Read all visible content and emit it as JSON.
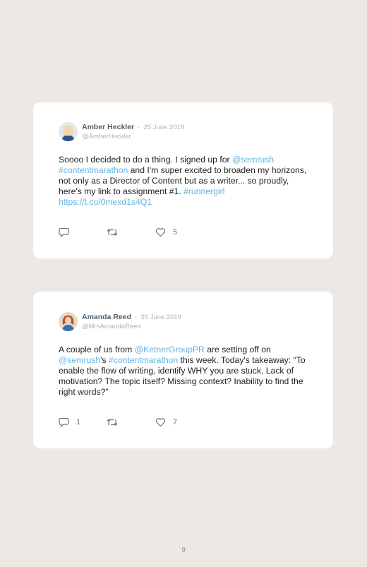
{
  "tweets": [
    {
      "name": "Amber Heckler",
      "separator": "·",
      "date": "25 June 2019",
      "handle": "@AmberHeckler",
      "avatar": "avatar-blonde-woman",
      "body_parts": [
        {
          "t": "Soooo I decided to do a thing. I signed up for "
        },
        {
          "t": "@semrush",
          "link": true
        },
        {
          "t": " "
        },
        {
          "t": "#contentmarathon",
          "link": true
        },
        {
          "t": " and I'm super excited to broaden my horizons, not only as a Director of Content but as a writer... so proudly, here's my link to assignment #1. "
        },
        {
          "t": "#runnergirl",
          "link": true
        },
        {
          "t": " "
        },
        {
          "t": "https://t.co/0mexd1s4Q1",
          "link": true
        }
      ],
      "replies": "",
      "likes": "5"
    },
    {
      "name": "Amanda Reed",
      "separator": "·",
      "date": "25 June 2019",
      "handle": "@MrsAmandaReed",
      "avatar": "avatar-redhead-woman",
      "body_parts": [
        {
          "t": "A couple of us from "
        },
        {
          "t": "@KetnerGroupPR",
          "link": true
        },
        {
          "t": " are setting off on "
        },
        {
          "t": "@semrush",
          "link": true
        },
        {
          "t": "'s "
        },
        {
          "t": "#contentmarathon",
          "link": true
        },
        {
          "t": " this week. Today's takeaway: \"To enable the flow of writing, identify WHY you are stuck. Lack of motivation? The topic itself? Missing context? Inability to find the right words?\""
        }
      ],
      "replies": "1",
      "likes": "7"
    }
  ],
  "icons": {
    "reply": "reply-icon",
    "retweet": "retweet-icon",
    "like": "heart-icon"
  },
  "colors": {
    "background": "#ede8e4",
    "card": "#ffffff",
    "link": "#5fb4e3",
    "name": "#50606d",
    "muted": "#a9b3bb"
  },
  "page_number": "9"
}
